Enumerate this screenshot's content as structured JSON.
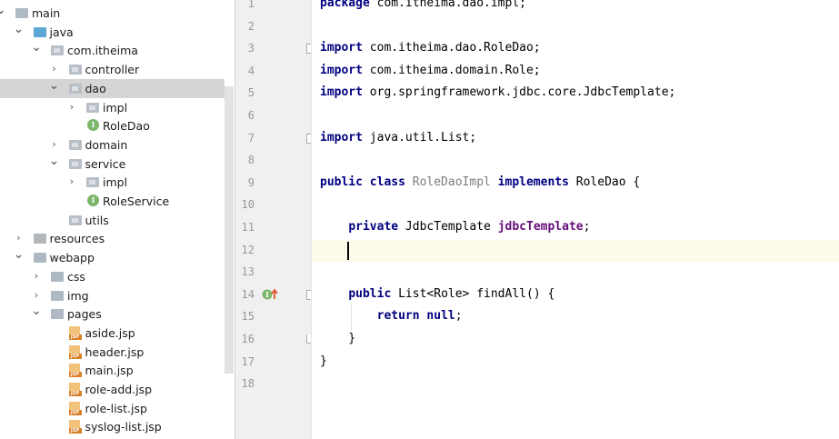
{
  "project_tree": {
    "items": [
      {
        "label": "main",
        "expanded": true,
        "icon": "folder-icon",
        "kind": "folder"
      },
      {
        "label": "java",
        "expanded": true,
        "icon": "source-folder-icon",
        "kind": "src"
      },
      {
        "label": "com.itheima",
        "expanded": true,
        "icon": "package-icon",
        "kind": "pkg"
      },
      {
        "label": "controller",
        "expanded": false,
        "icon": "package-icon",
        "kind": "pkg"
      },
      {
        "label": "dao",
        "expanded": true,
        "icon": "package-icon",
        "kind": "pkg",
        "selected": true
      },
      {
        "label": "impl",
        "expanded": false,
        "icon": "package-icon",
        "kind": "pkg"
      },
      {
        "label": "RoleDao",
        "icon": "interface-icon",
        "kind": "interface"
      },
      {
        "label": "domain",
        "expanded": false,
        "icon": "package-icon",
        "kind": "pkg"
      },
      {
        "label": "service",
        "expanded": true,
        "icon": "package-icon",
        "kind": "pkg"
      },
      {
        "label": "impl",
        "expanded": false,
        "icon": "package-icon",
        "kind": "pkg"
      },
      {
        "label": "RoleService",
        "icon": "interface-icon",
        "kind": "interface"
      },
      {
        "label": "utils",
        "icon": "package-icon",
        "kind": "pkg"
      },
      {
        "label": "resources",
        "expanded": false,
        "icon": "resources-folder-icon",
        "kind": "res"
      },
      {
        "label": "webapp",
        "expanded": true,
        "icon": "folder-icon",
        "kind": "folder"
      },
      {
        "label": "css",
        "expanded": false,
        "icon": "folder-icon",
        "kind": "folder"
      },
      {
        "label": "img",
        "expanded": false,
        "icon": "folder-icon",
        "kind": "folder"
      },
      {
        "label": "pages",
        "expanded": true,
        "icon": "folder-icon",
        "kind": "folder"
      },
      {
        "label": "aside.jsp",
        "icon": "jsp-file-icon",
        "kind": "jsp"
      },
      {
        "label": "header.jsp",
        "icon": "jsp-file-icon",
        "kind": "jsp"
      },
      {
        "label": "main.jsp",
        "icon": "jsp-file-icon",
        "kind": "jsp"
      },
      {
        "label": "role-add.jsp",
        "icon": "jsp-file-icon",
        "kind": "jsp"
      },
      {
        "label": "role-list.jsp",
        "icon": "jsp-file-icon",
        "kind": "jsp"
      },
      {
        "label": "syslog-list.jsp",
        "icon": "jsp-file-icon",
        "kind": "jsp"
      }
    ],
    "interface_badge": "I",
    "jsp_badge": "JSP"
  },
  "editor": {
    "current_line": 12,
    "lines": [
      {
        "n": "1",
        "tokens": [
          {
            "t": "package",
            "c": "kw"
          },
          {
            "t": " com.itheima.dao.impl;",
            "c": ""
          }
        ]
      },
      {
        "n": "2",
        "tokens": []
      },
      {
        "n": "3",
        "tokens": [
          {
            "t": "import",
            "c": "kw"
          },
          {
            "t": " com.itheima.dao.RoleDao;",
            "c": ""
          }
        ]
      },
      {
        "n": "4",
        "tokens": [
          {
            "t": "import",
            "c": "kw"
          },
          {
            "t": " com.itheima.domain.Role;",
            "c": ""
          }
        ]
      },
      {
        "n": "5",
        "tokens": [
          {
            "t": "import",
            "c": "kw"
          },
          {
            "t": " org.springframework.jdbc.core.JdbcTemplate;",
            "c": ""
          }
        ]
      },
      {
        "n": "6",
        "tokens": []
      },
      {
        "n": "7",
        "tokens": [
          {
            "t": "import",
            "c": "kw"
          },
          {
            "t": " java.util.List;",
            "c": ""
          }
        ]
      },
      {
        "n": "8",
        "tokens": []
      },
      {
        "n": "9",
        "tokens": [
          {
            "t": "public class",
            "c": "kw"
          },
          {
            "t": " ",
            "c": ""
          },
          {
            "t": "RoleDaoImpl",
            "c": "cls-unused"
          },
          {
            "t": " ",
            "c": ""
          },
          {
            "t": "implements",
            "c": "kw"
          },
          {
            "t": " RoleDao {",
            "c": ""
          }
        ]
      },
      {
        "n": "10",
        "tokens": []
      },
      {
        "n": "11",
        "tokens": [
          {
            "t": "    ",
            "c": ""
          },
          {
            "t": "private",
            "c": "kw"
          },
          {
            "t": " JdbcTemplate ",
            "c": ""
          },
          {
            "t": "jdbcTemplate",
            "c": "field"
          },
          {
            "t": ";",
            "c": ""
          }
        ]
      },
      {
        "n": "12",
        "tokens": []
      },
      {
        "n": "13",
        "tokens": []
      },
      {
        "n": "14",
        "tokens": [
          {
            "t": "    ",
            "c": ""
          },
          {
            "t": "public",
            "c": "kw"
          },
          {
            "t": " List<Role> findAll() {",
            "c": ""
          }
        ]
      },
      {
        "n": "15",
        "tokens": [
          {
            "t": "        ",
            "c": ""
          },
          {
            "t": "return null",
            "c": "kw"
          },
          {
            "t": ";",
            "c": ""
          }
        ]
      },
      {
        "n": "16",
        "tokens": [
          {
            "t": "    }",
            "c": ""
          }
        ]
      },
      {
        "n": "17",
        "tokens": [
          {
            "t": "}",
            "c": ""
          }
        ]
      },
      {
        "n": "18",
        "tokens": []
      }
    ],
    "gutter_markers": {
      "line_14": "implements-method-icon"
    }
  },
  "colors": {
    "keyword": "#000080",
    "field": "#660e7a",
    "unused_class": "#7d7d7d",
    "current_line": "#fcfae8",
    "gutter_bg": "#f0f0f0",
    "selection": "#d5d5d5"
  }
}
